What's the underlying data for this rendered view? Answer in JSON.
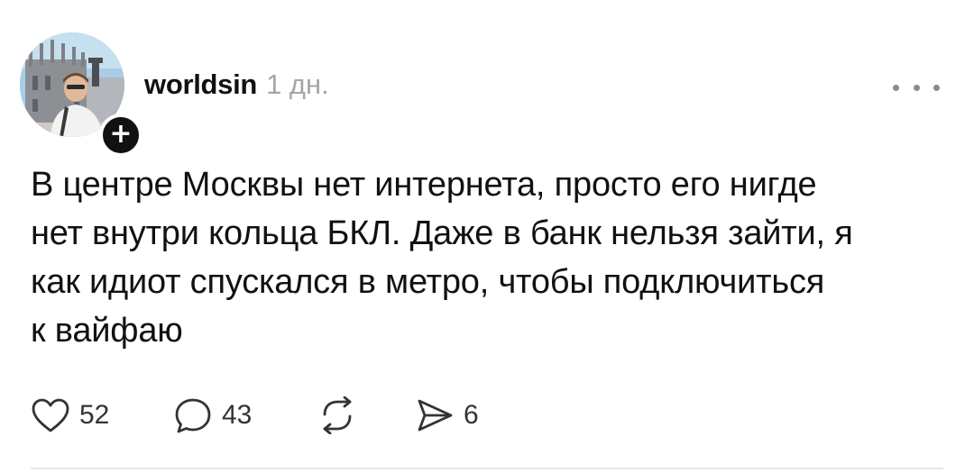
{
  "post": {
    "author": {
      "username": "worldsin",
      "follow_symbol": "+"
    },
    "timestamp": "1 дн.",
    "text_lines": [
      "В центре Москвы нет интернета, просто его нигде",
      "нет внутри кольца БКЛ. Даже в банк нельзя зайти, я",
      "как идиот спускался в метро, чтобы подключиться",
      "к вайфаю"
    ],
    "actions": {
      "likes": {
        "icon": "heart-icon",
        "count": "52"
      },
      "comments": {
        "icon": "comment-bubble-icon",
        "count": "43"
      },
      "reposts": {
        "icon": "repost-icon",
        "count": ""
      },
      "shares": {
        "icon": "send-icon",
        "count": "6"
      }
    },
    "menu_icon": "more-dots-icon"
  },
  "colors": {
    "text": "#111111",
    "muted": "#a6a6a6",
    "icon": "#333333",
    "divider": "#e6e6e6"
  }
}
